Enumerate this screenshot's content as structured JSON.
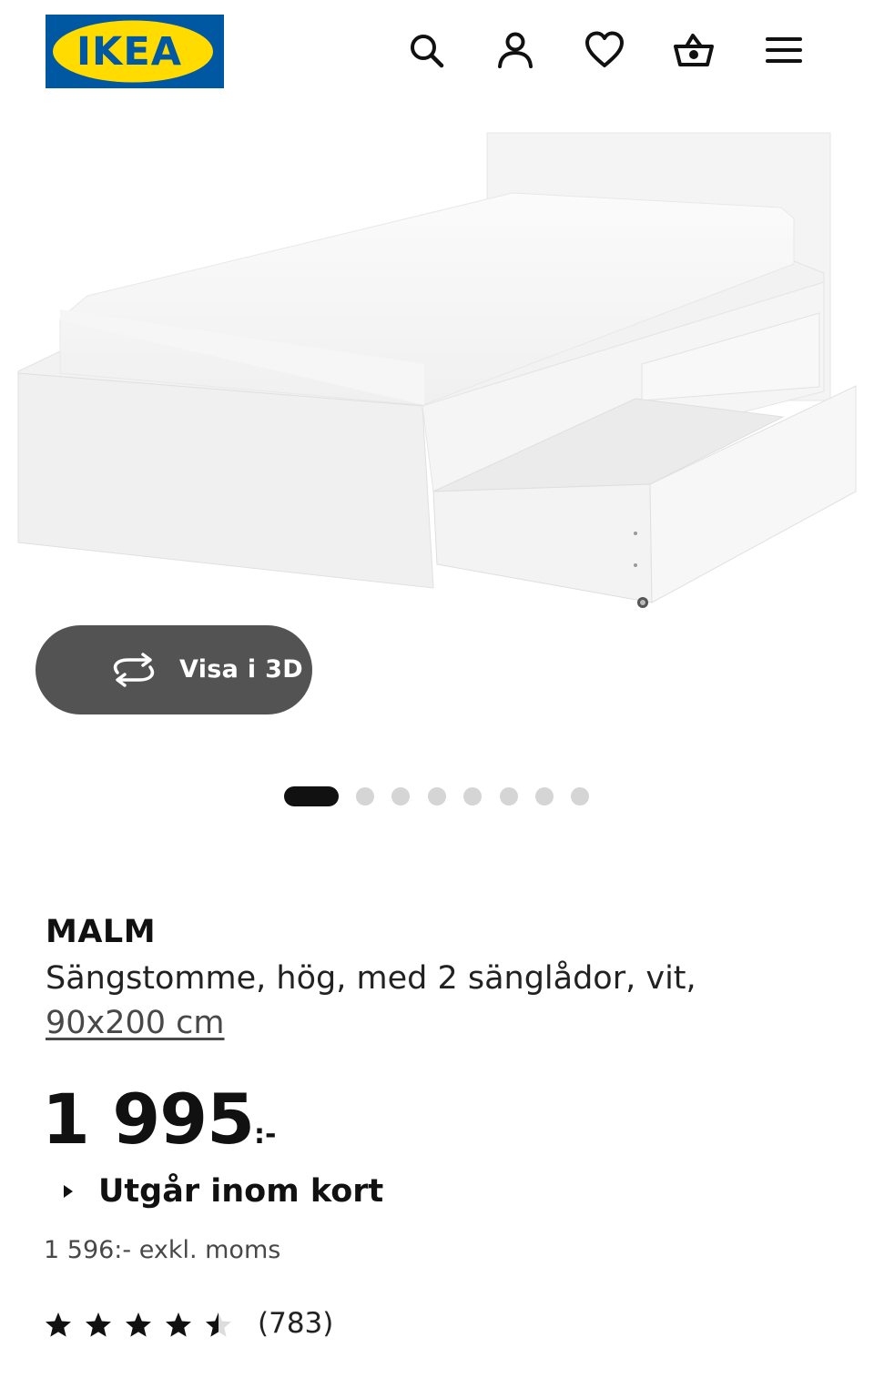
{
  "header": {
    "logo_text": "IKEA",
    "icons": [
      "search-icon",
      "account-icon",
      "heart-icon",
      "basket-icon",
      "menu-icon"
    ],
    "brand_colors": {
      "blue": "#0058A3",
      "yellow": "#FFDB00"
    }
  },
  "hero": {
    "view_3d_label": "Visa i 3D",
    "carousel_count": 8,
    "carousel_active": 1
  },
  "product": {
    "name": "MALM",
    "description": "Sängstomme, hög, med 2 sänglådor, vit,",
    "size": "90x200 cm",
    "price_main": "1 995",
    "price_suffix": ":-",
    "availability": "Utgår inom kort",
    "price_ex_vat": "1 596:- exkl. moms",
    "rating": {
      "stars": 4.5,
      "max_stars": 5,
      "review_count": "(783)"
    }
  }
}
